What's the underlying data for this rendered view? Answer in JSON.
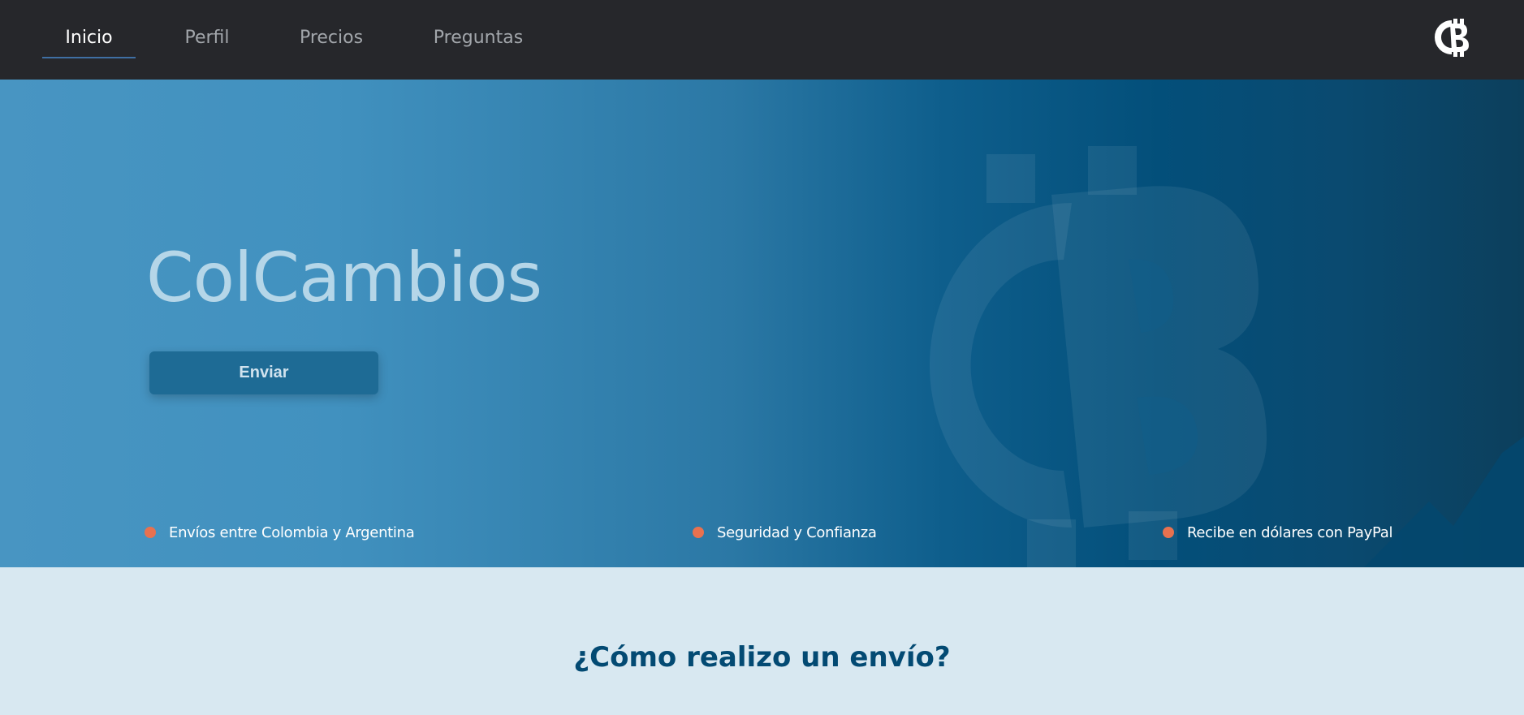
{
  "nav": {
    "items": [
      {
        "label": "Inicio",
        "active": true
      },
      {
        "label": "Perfil",
        "active": false
      },
      {
        "label": "Precios",
        "active": false
      },
      {
        "label": "Preguntas",
        "active": false
      }
    ],
    "logo_icon": "colcambios-logo-icon"
  },
  "hero": {
    "title": "ColCambios",
    "button_label": "Enviar",
    "features": [
      "Envíos entre Colombia y Argentina",
      "Seguridad y Confianza",
      "Recibe en dólares con PayPal"
    ],
    "watermark_icon": "colcambios-logo-watermark-icon"
  },
  "section": {
    "title": "¿Cómo realizo un envío?"
  },
  "colors": {
    "nav_bg": "#26272b",
    "accent_underline": "#3f6fa3",
    "feature_dot": "#e8714f",
    "section_bg": "#d8e8f1",
    "section_title": "#034a73"
  }
}
